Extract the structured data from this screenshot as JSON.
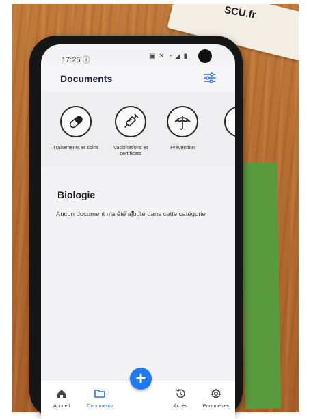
{
  "backdrop": {
    "paper_text": "SCU.fr"
  },
  "status_bar": {
    "time": "17:26 ⓘ",
    "icons": "▣ ✕ ◔ ◢ ▮"
  },
  "header": {
    "title": "Documents",
    "filter_icon": "tune-icon"
  },
  "categories": {
    "items": [
      {
        "label": "Traitements et soins",
        "icon": "pill-icon"
      },
      {
        "label": "Vaccinations et certificats",
        "icon": "syringe-icon"
      },
      {
        "label": "Prévention",
        "icon": "umbrella-icon"
      }
    ],
    "page_count": 4,
    "active_page": 3
  },
  "section": {
    "title": "Biologie",
    "message": "Aucun document n'a été ajouté dans cette catégorie"
  },
  "bottom_nav": {
    "items": [
      {
        "label": "Accueil",
        "icon": "home-icon"
      },
      {
        "label": "Documents",
        "icon": "folder-icon",
        "active": true
      },
      {
        "label": "Accès",
        "icon": "history-icon"
      },
      {
        "label": "Paramètres",
        "icon": "settings-icon"
      }
    ],
    "fab_label": "+"
  },
  "colors": {
    "accent": "#1f79f2",
    "active_nav": "#2a6ff0",
    "header_title": "#1f2340"
  }
}
